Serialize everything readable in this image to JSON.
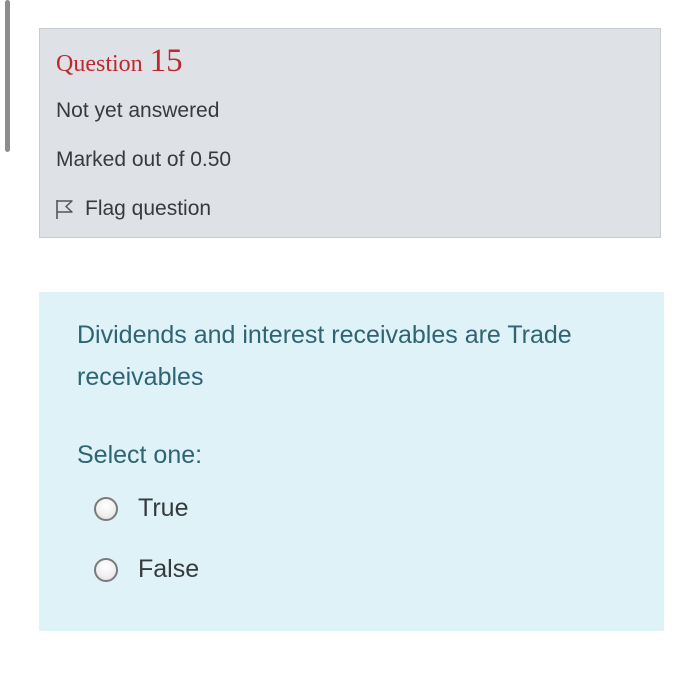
{
  "question_info": {
    "question_word": "Question",
    "question_number": "15",
    "state": "Not yet answered",
    "grade": "Marked out of 0.50",
    "flag_label": "Flag question",
    "flag_icon": "flag-outline-icon"
  },
  "question_content": {
    "text": "Dividends and interest receivables are Trade receivables",
    "prompt": "Select one:",
    "options": [
      {
        "label": "True",
        "selected": false
      },
      {
        "label": "False",
        "selected": false
      }
    ]
  },
  "colors": {
    "question_header": "#c0282d",
    "info_background": "#dee2e6",
    "content_background": "#def2f8",
    "content_text": "#2f6473",
    "body_text": "#373a3c"
  }
}
